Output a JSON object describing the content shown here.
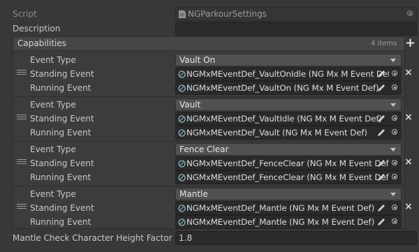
{
  "inspector": {
    "script_label": "Script",
    "script_value": "NGParkourSettings",
    "description_label": "Description",
    "description_value": "",
    "capabilities": {
      "title": "Capabilities",
      "count": "4 items",
      "add_label": "+",
      "row_labels": {
        "event_type": "Event Type",
        "standing_event": "Standing Event",
        "running_event": "Running Event"
      },
      "items": [
        {
          "event_type": "Vault On",
          "standing": "NGMxMEventDef_VaultOnIdle (NG Mx M Event Def)",
          "running": "NGMxMEventDef_VaultOn (NG Mx M Event Def)"
        },
        {
          "event_type": "Vault",
          "standing": "NGMxMEventDef_VaultIdle (NG Mx M Event Def)",
          "running": "NGMxMEventDef_Vault (NG Mx M Event Def)"
        },
        {
          "event_type": "Fence Clear",
          "standing": "NGMxMEventDef_FenceClear (NG Mx M Event Def)",
          "running": "NGMxMEventDef_FenceClear (NG Mx M Event Def)"
        },
        {
          "event_type": "Mantle",
          "standing": "NGMxMEventDef_Mantle (NG Mx M Event Def)",
          "running": "NGMxMEventDef_Mantle (NG Mx M Event Def)"
        }
      ]
    },
    "mantle_label": "Mantle Check Character Height Factor",
    "mantle_value": "1.8",
    "remove_label": "×"
  }
}
